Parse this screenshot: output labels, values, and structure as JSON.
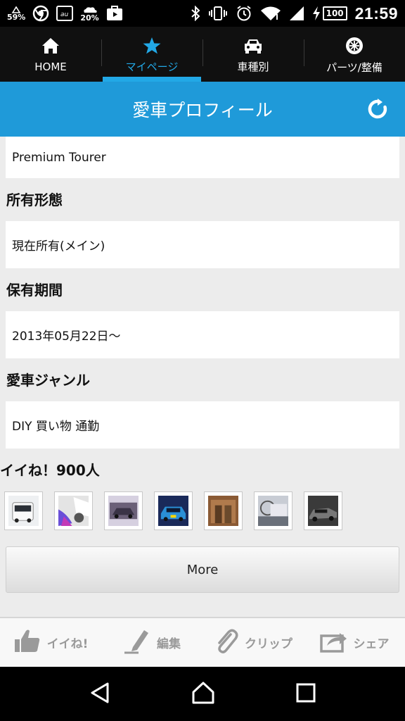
{
  "status_bar": {
    "left_percent_1": "59%",
    "left_percent_2": "20%",
    "battery": "100",
    "time": "21:59",
    "icons": [
      "data-saver-icon",
      "chrome-icon",
      "au-icon",
      "weather-icon",
      "youtube-icon",
      "bluetooth-icon",
      "vibrate-icon",
      "alarm-icon",
      "wifi-icon",
      "signal-icon",
      "charging-icon"
    ]
  },
  "nav": {
    "tabs": [
      {
        "label": "HOME",
        "icon": "home-icon",
        "active": false
      },
      {
        "label": "マイページ",
        "icon": "star-icon",
        "active": true
      },
      {
        "label": "車種別",
        "icon": "car-icon",
        "active": false
      },
      {
        "label": "パーツ/整備",
        "icon": "wheel-icon",
        "active": false
      }
    ]
  },
  "header": {
    "title": "愛車プロフィール",
    "refresh_icon": "refresh-icon"
  },
  "profile": {
    "grade_value": "Premium Tourer",
    "ownership_heading": "所有形態",
    "ownership_value": "現在所有(メイン)",
    "period_heading": "保有期間",
    "period_value": "2013年05月22日～",
    "genre_heading": "愛車ジャンル",
    "genre_value": "DIY 買い物 通勤",
    "likes_heading": "イイね！900人",
    "more_label": "More"
  },
  "actions": [
    {
      "label": "イイね!",
      "icon": "thumbs-up-icon"
    },
    {
      "label": "編集",
      "icon": "pen-icon"
    },
    {
      "label": "クリップ",
      "icon": "paperclip-icon"
    },
    {
      "label": "シェア",
      "icon": "share-icon"
    }
  ],
  "colors": {
    "accent": "#1f9ad9",
    "nav_bg": "#101010",
    "active_tab": "#22a8e6"
  }
}
